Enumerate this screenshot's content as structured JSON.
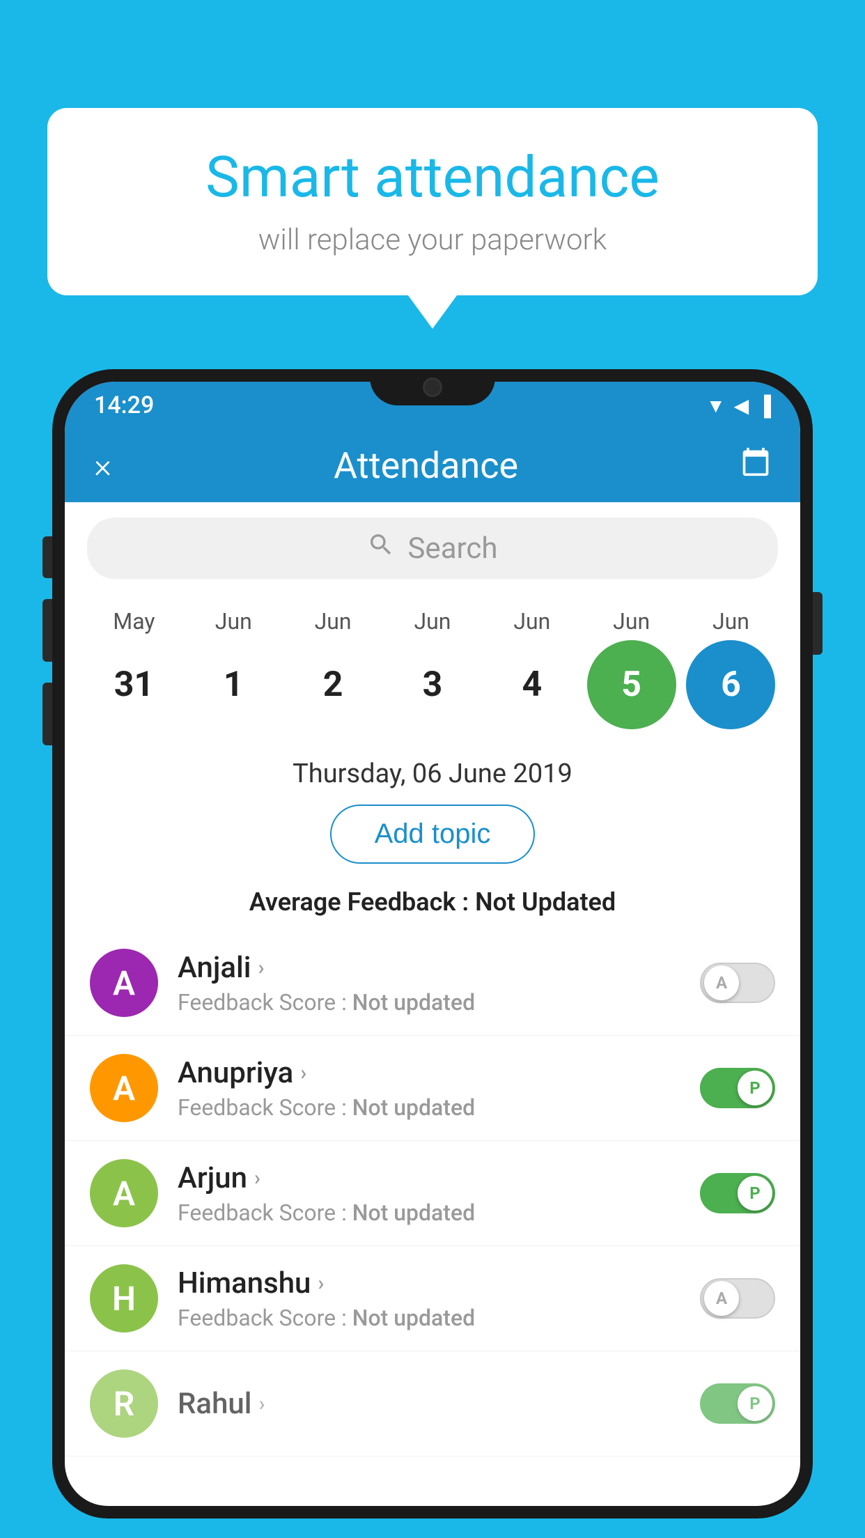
{
  "background_color": "#1ab8e8",
  "bubble": {
    "title": "Smart attendance",
    "subtitle": "will replace your paperwork"
  },
  "status_bar": {
    "time": "14:29",
    "signal_icons": "▼◀▐"
  },
  "header": {
    "title": "Attendance",
    "close_label": "×",
    "calendar_icon": "🗓"
  },
  "search": {
    "placeholder": "Search"
  },
  "calendar": {
    "months": [
      "May",
      "Jun",
      "Jun",
      "Jun",
      "Jun",
      "Jun",
      "Jun"
    ],
    "dates": [
      "31",
      "1",
      "2",
      "3",
      "4",
      "5",
      "6"
    ],
    "selected_green": "5",
    "selected_blue": "6"
  },
  "selected_date_label": "Thursday, 06 June 2019",
  "add_topic_label": "Add topic",
  "avg_feedback_label": "Average Feedback :",
  "avg_feedback_value": "Not Updated",
  "students": [
    {
      "name": "Anjali",
      "avatar_letter": "A",
      "avatar_color": "purple",
      "feedback_label": "Feedback Score :",
      "feedback_value": "Not updated",
      "toggle_state": "off",
      "toggle_letter": "A"
    },
    {
      "name": "Anupriya",
      "avatar_letter": "A",
      "avatar_color": "orange",
      "feedback_label": "Feedback Score :",
      "feedback_value": "Not updated",
      "toggle_state": "on",
      "toggle_letter": "P"
    },
    {
      "name": "Arjun",
      "avatar_letter": "A",
      "avatar_color": "green",
      "feedback_label": "Feedback Score :",
      "feedback_value": "Not updated",
      "toggle_state": "on",
      "toggle_letter": "P"
    },
    {
      "name": "Himanshu",
      "avatar_letter": "H",
      "avatar_color": "teal",
      "feedback_label": "Feedback Score :",
      "feedback_value": "Not updated",
      "toggle_state": "off",
      "toggle_letter": "A"
    }
  ]
}
